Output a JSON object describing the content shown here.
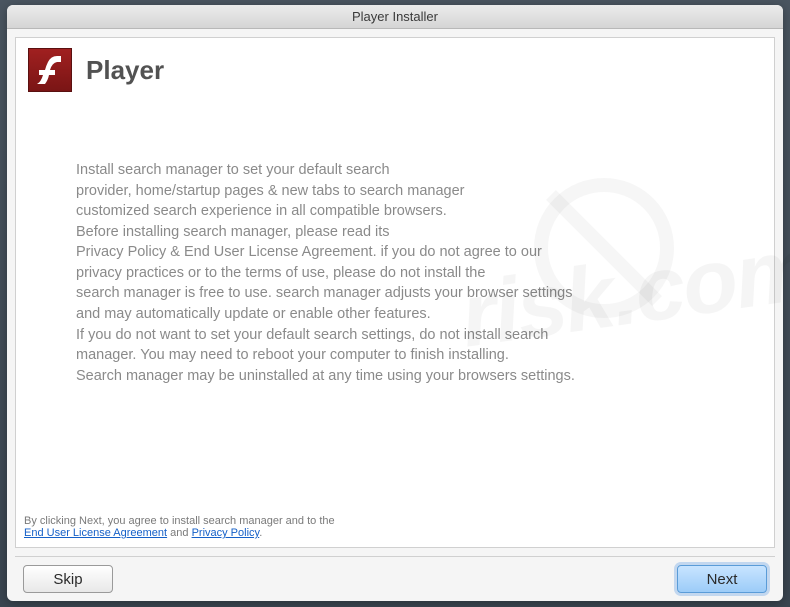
{
  "window": {
    "title": "Player Installer"
  },
  "header": {
    "app_name": "Player",
    "icon_name": "flash-player-icon"
  },
  "body": {
    "line1": "Install search manager to set your default search",
    "line2": "provider, home/startup pages & new tabs to search manager",
    "line3": "customized search experience in all compatible browsers.",
    "line4": "Before installing search manager, please read its",
    "line5": "Privacy Policy & End User License Agreement. if you do not agree to our",
    "line6": "privacy practices or to the terms of use, please do not install the",
    "line7": "search manager is free to use. search manager adjusts your browser settings",
    "line8": "and may automatically update or enable other features.",
    "line9": "If you do not want to set your default search settings, do not install search",
    "line10": "manager. You may need to reboot your computer to finish installing.",
    "line11": "Search manager may be uninstalled at any time using your browsers settings."
  },
  "footer": {
    "prefix": "By clicking Next, you agree to install search manager and to the",
    "eula_link": "End User License Agreement",
    "and": " and ",
    "privacy_link": "Privacy Policy",
    "suffix": "."
  },
  "buttons": {
    "skip": "Skip",
    "next": "Next"
  },
  "watermark": {
    "text": "risk.com"
  }
}
